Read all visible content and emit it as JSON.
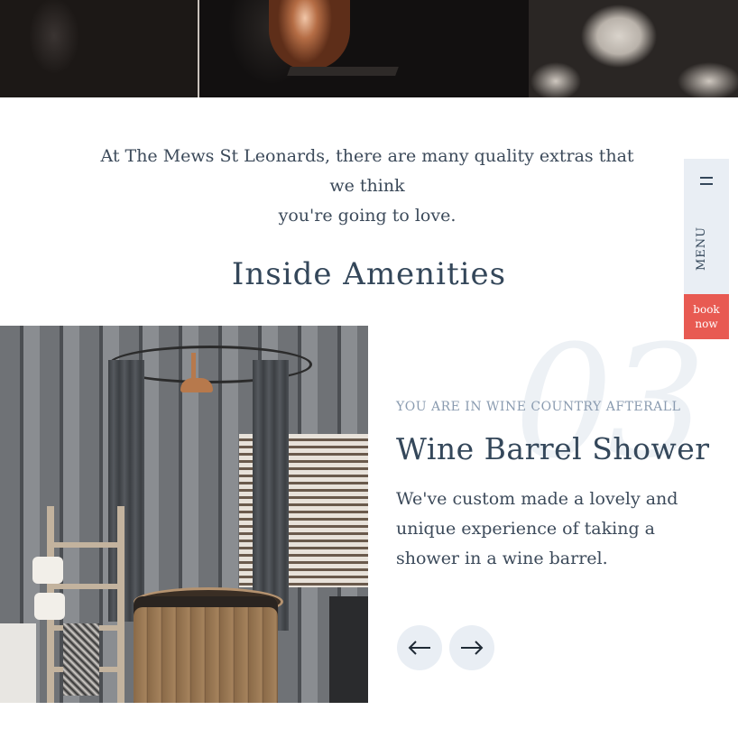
{
  "intro": {
    "line1": "At The Mews St Leonards, there are many quality extras that we think",
    "line2": "you're going to love."
  },
  "section": {
    "title": "Inside Amenities"
  },
  "feature": {
    "number": "03",
    "eyebrow": "YOU ARE IN WINE COUNTRY AFTERALL",
    "title": "Wine Barrel Shower",
    "description": "We've custom made a lovely and unique experience of taking a shower in a wine barrel."
  },
  "carousel": {
    "prev_icon": "arrow-left-icon",
    "next_icon": "arrow-right-icon"
  },
  "side_menu": {
    "menu_label": "MENU",
    "book_line1": "book",
    "book_line2": "now"
  },
  "colors": {
    "accent": "#e85a52",
    "panel": "#e9eef4",
    "text": "#34475a"
  }
}
